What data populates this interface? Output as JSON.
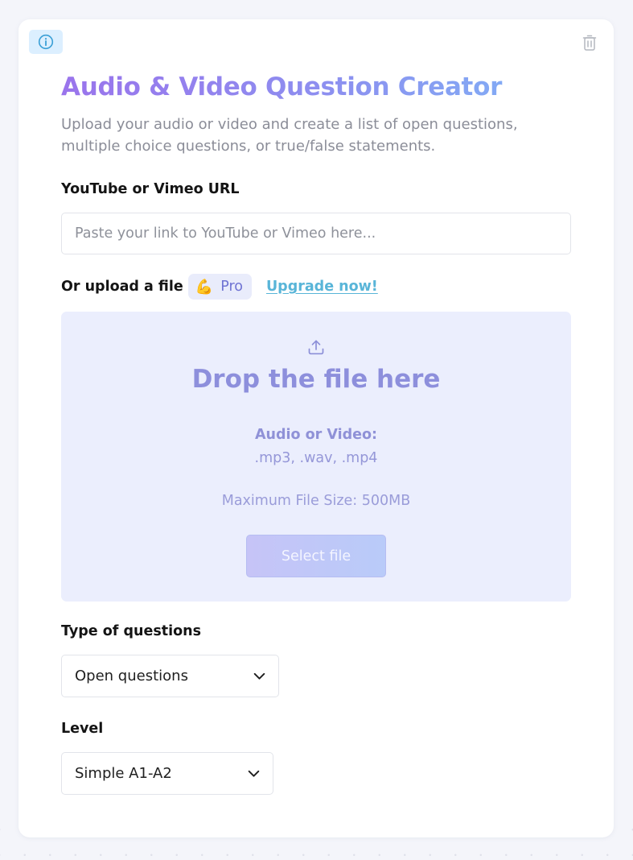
{
  "card": {
    "title": "Audio & Video Question Creator",
    "subtitle": "Upload your audio or video and create a list of open questions, multiple choice questions, or true/false statements."
  },
  "icons": {
    "info": "info-icon",
    "trash": "trash-icon",
    "upload": "upload-icon",
    "chevron": "chevron-down-icon",
    "pro": "flexed-biceps-icon"
  },
  "url_field": {
    "label": "YouTube or Vimeo URL",
    "placeholder": "Paste your link to YouTube or Vimeo here...",
    "value": ""
  },
  "upload": {
    "label": "Or upload a file",
    "pro_badge": "Pro",
    "pro_emoji": "💪",
    "upgrade_link": "Upgrade now!",
    "drop_title": "Drop the file here",
    "type_heading": "Audio or Video:",
    "extensions": ".mp3, .wav, .mp4",
    "max_size": "Maximum File Size: 500MB",
    "select_button": "Select file"
  },
  "question_type": {
    "label": "Type of questions",
    "selected": "Open questions"
  },
  "level": {
    "label": "Level",
    "selected": "Simple A1-A2"
  },
  "colors": {
    "title_gradient_start": "#9a74ec",
    "title_gradient_end": "#7fb4f6",
    "dropzone_bg": "#ebeefd",
    "link": "#59b5d8",
    "info_bg": "#dcefff"
  }
}
